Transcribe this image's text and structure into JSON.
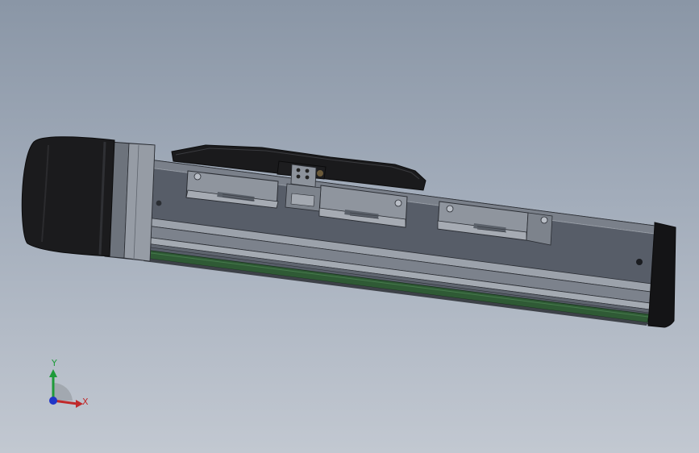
{
  "view": {
    "background_top": "#8a96a6",
    "background_bottom": "#c2c8d1"
  },
  "model": {
    "parts": [
      "motor",
      "motor-flange",
      "rail-body",
      "belt-strip",
      "end-cap",
      "top-carriage",
      "carriage-left",
      "carriage-right",
      "sensor-bracket"
    ],
    "colors": {
      "body": "#535a65",
      "rail": "#868d97",
      "belt": "#2f5a35",
      "motor": "#1b1b1d",
      "plate": "#9ba0a8",
      "edge": "#2a2d33"
    }
  },
  "triad": {
    "x_label": "X",
    "y_label": "Y",
    "x_color": "#c0292b",
    "y_color": "#1f9a3a",
    "z_color": "#2035c8"
  }
}
